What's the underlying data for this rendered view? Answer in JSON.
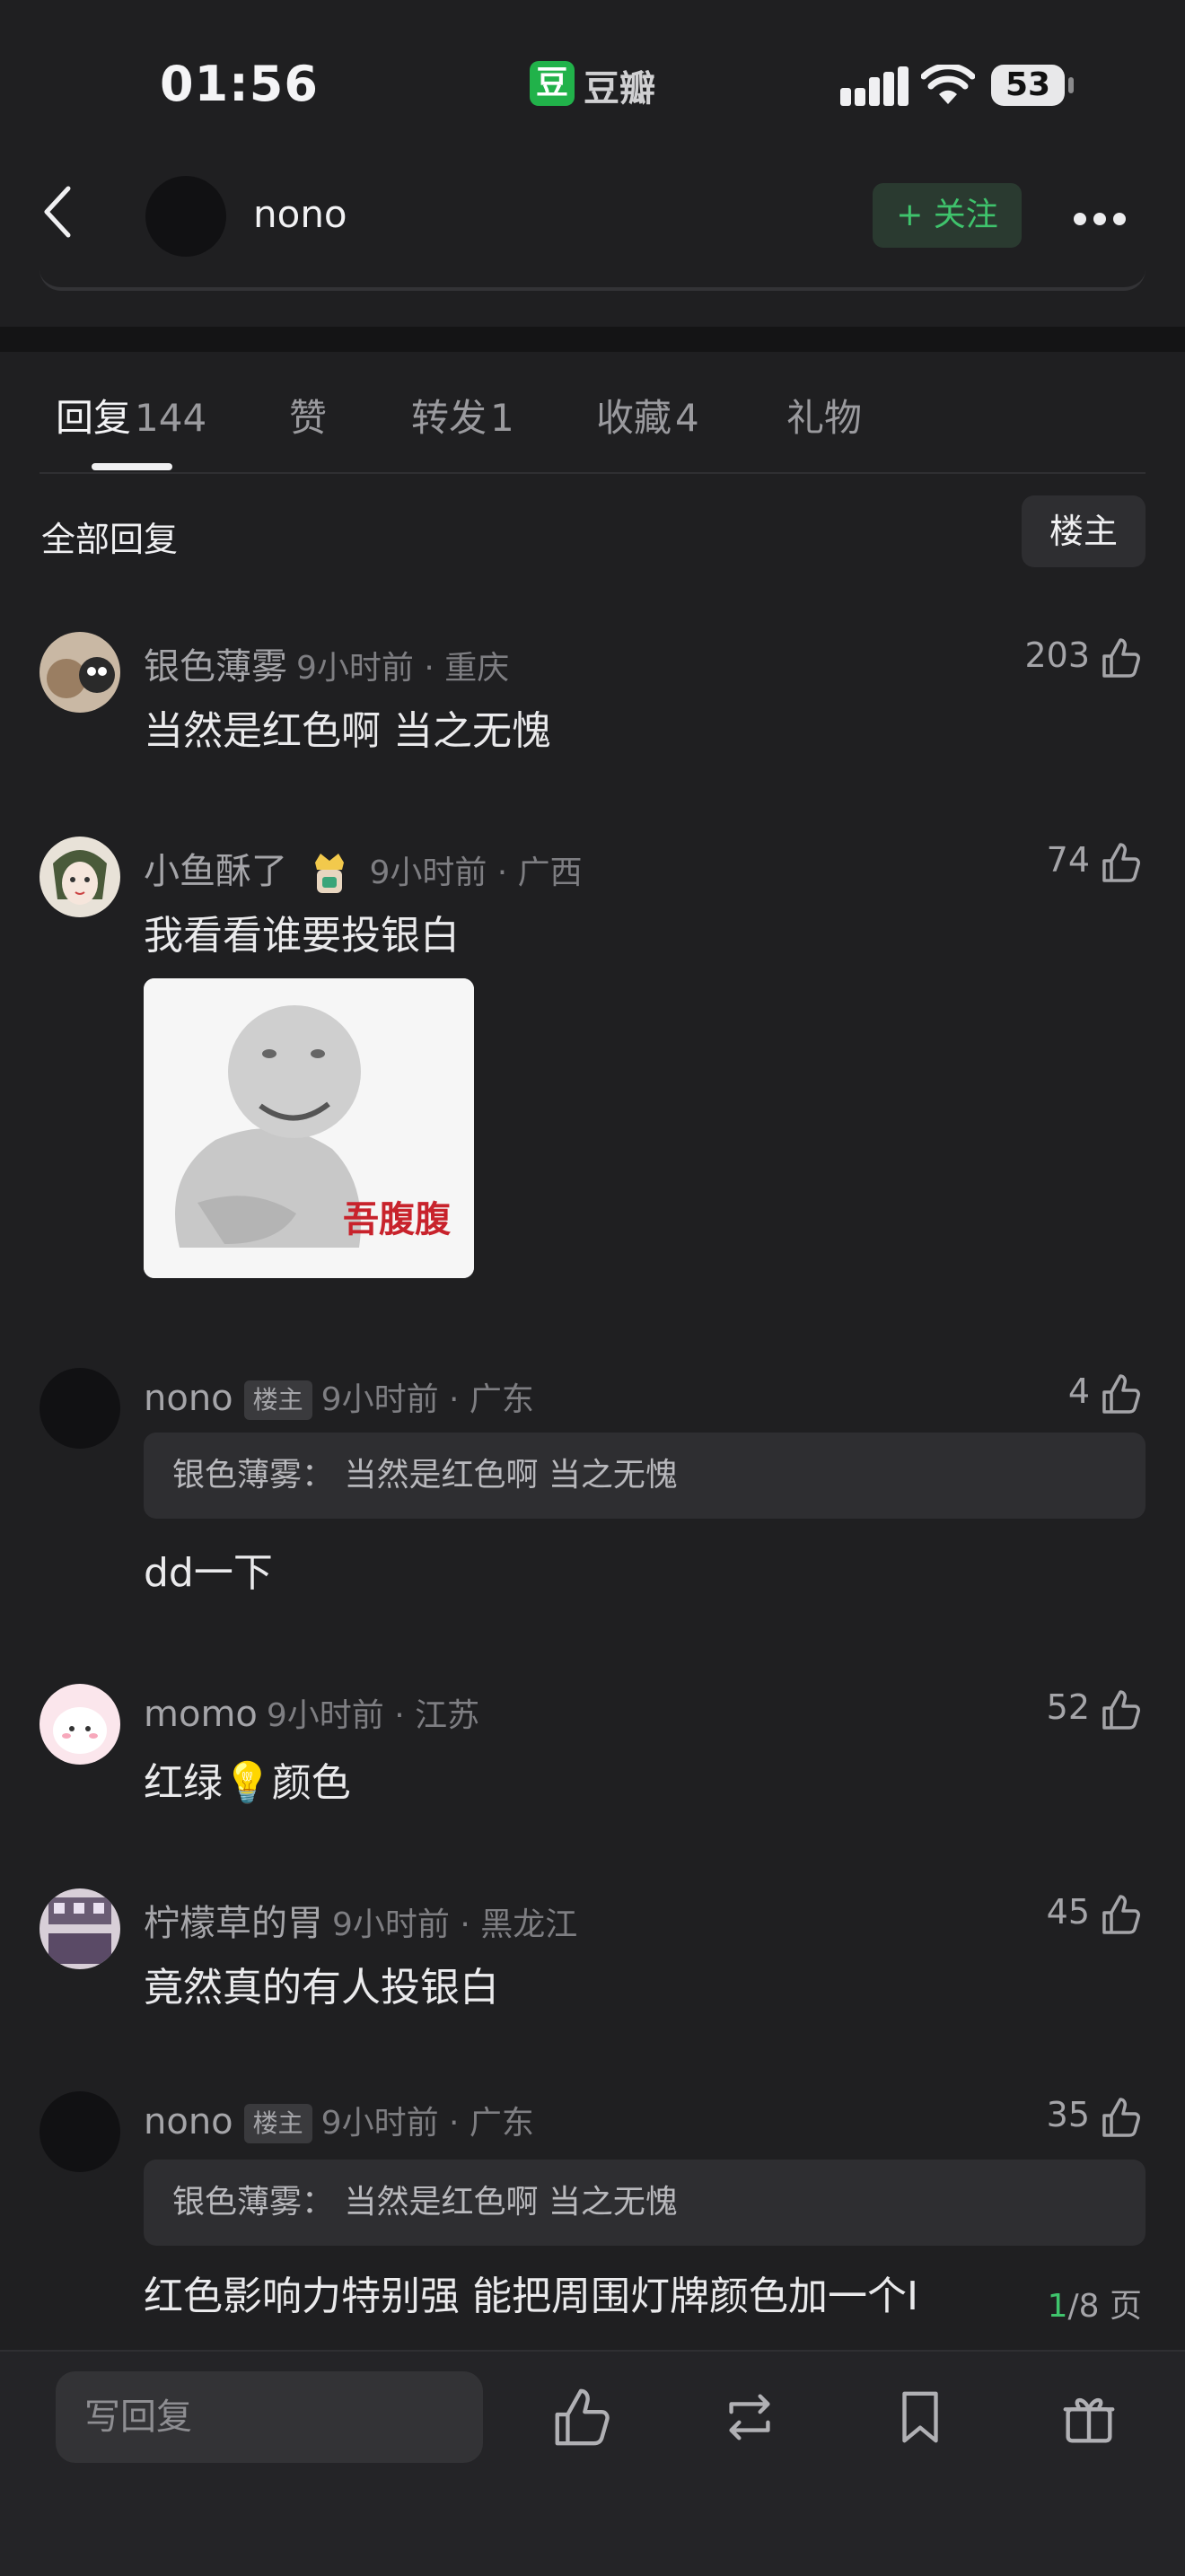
{
  "status_bar": {
    "time": "01:56",
    "app_badge": "豆",
    "app_name": "豆瓣",
    "battery": "53"
  },
  "header": {
    "author_name": "nono",
    "follow_label": "+ 关注"
  },
  "tabs": [
    {
      "label": "回复",
      "count": "144"
    },
    {
      "label": "赞",
      "count": ""
    },
    {
      "label": "转发",
      "count": "1"
    },
    {
      "label": "收藏",
      "count": "4"
    },
    {
      "label": "礼物",
      "count": ""
    }
  ],
  "section": {
    "title": "全部回复",
    "op_filter_label": "楼主"
  },
  "comments": [
    {
      "user": "银色薄雾",
      "tag": "",
      "time": "9小时前 · 重庆",
      "likes": "203",
      "quote": "",
      "text": "当然是红色啊 当之无愧"
    },
    {
      "user": "小鱼酥了",
      "tag": "",
      "time": "9小时前 · 广西",
      "likes": "74",
      "quote": "",
      "text": "我看看谁要投银白",
      "sticker_text": "吾腹腹"
    },
    {
      "user": "nono",
      "tag": "楼主",
      "time": "9小时前 · 广东",
      "likes": "4",
      "quote": "银色薄雾： 当然是红色啊 当之无愧",
      "text": "dd一下"
    },
    {
      "user": "momo",
      "tag": "",
      "time": "9小时前 · 江苏",
      "likes": "52",
      "quote": "",
      "text": "红绿💡颜色"
    },
    {
      "user": "柠檬草的胃",
      "tag": "",
      "time": "9小时前 · 黑龙江",
      "likes": "45",
      "quote": "",
      "text": "竟然真的有人投银白"
    },
    {
      "user": "nono",
      "tag": "楼主",
      "time": "9小时前 · 广东",
      "likes": "35",
      "quote": "银色薄雾： 当然是红色啊 当之无愧",
      "text": "红色影响力特别强 能把周围灯牌颜色加一个Ⅰ"
    }
  ],
  "pager": {
    "current": "1",
    "total": "/8 页"
  },
  "bottom_bar": {
    "reply_placeholder": "写回复"
  },
  "colors": {
    "accent_green": "#3fc36c",
    "background": "#1f1f21"
  }
}
